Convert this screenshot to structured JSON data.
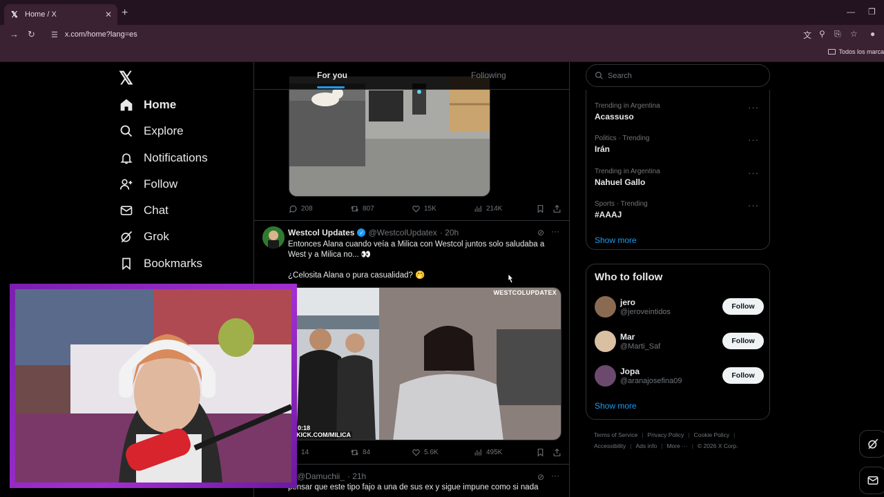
{
  "browser": {
    "tab_title": "Home / X",
    "url": "x.com/home?lang=es",
    "bookmarks_folder": "Todos los marca"
  },
  "nav": {
    "items": [
      {
        "label": "Home",
        "icon": "home-icon",
        "active": true
      },
      {
        "label": "Explore",
        "icon": "search-icon"
      },
      {
        "label": "Notifications",
        "icon": "bell-icon"
      },
      {
        "label": "Follow",
        "icon": "person-plus-icon"
      },
      {
        "label": "Chat",
        "icon": "mail-icon"
      },
      {
        "label": "Grok",
        "icon": "grok-icon"
      },
      {
        "label": "Bookmarks",
        "icon": "bookmark-icon"
      }
    ]
  },
  "timeline": {
    "tabs": [
      "For you",
      "Following"
    ],
    "post1": {
      "replies": "208",
      "reposts": "807",
      "likes": "15K",
      "views": "214K"
    },
    "post2": {
      "name": "Westcol Updates",
      "handle": "@WestcolUpdatex",
      "time": "· 20h",
      "text1": "Entonces Alana cuando veía a Milica con Westcol juntos solo saludaba a West y a Milica no... 👀",
      "text2": "¿Celosita Alana o pura casualidad? 🤭",
      "watermark": "WESTCOLUPDATEX",
      "video_time": "0:18",
      "kick_label": "KICK.COM/MILICA",
      "replies": "14",
      "reposts": "84",
      "likes": "5.6K",
      "views": "495K"
    },
    "post3": {
      "handle": "@Damuchii_",
      "time": "· 21h",
      "text": "pensar que este tipo fajo a una de sus ex y sigue impune como si nada"
    }
  },
  "right": {
    "search_placeholder": "Search",
    "trends": [
      {
        "meta": "Trending in Argentina",
        "topic": "Acassuso"
      },
      {
        "meta": "Politics · Trending",
        "topic": "Irán"
      },
      {
        "meta": "Trending in Argentina",
        "topic": "Nahuel Gallo"
      },
      {
        "meta": "Sports · Trending",
        "topic": "#AAAJ"
      }
    ],
    "show_more": "Show more",
    "who_to_follow": "Who to follow",
    "follow_label": "Follow",
    "suggestions": [
      {
        "name": "jero",
        "handle": "@jeroveintidos"
      },
      {
        "name": "Mar",
        "handle": "@Marti_Saf"
      },
      {
        "name": "Jopa",
        "handle": "@aranajosefina09"
      }
    ],
    "footer": [
      "Terms of Service",
      "Privacy Policy",
      "Cookie Policy",
      "Accessibility",
      "Ads info",
      "More ···",
      "© 2026 X Corp."
    ]
  },
  "colors": {
    "accent": "#1d9bf0",
    "webcam_frame": "#a22fd0"
  }
}
